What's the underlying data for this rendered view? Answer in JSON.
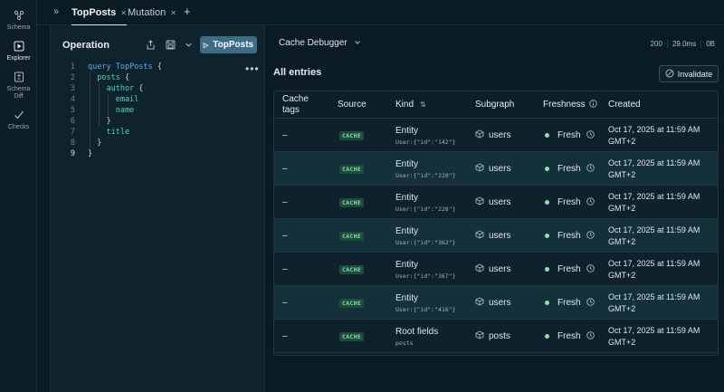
{
  "rail": {
    "items": [
      {
        "label": "Schema",
        "icon": "schema-icon"
      },
      {
        "label": "Explorer",
        "icon": "play-square-icon",
        "active": true
      },
      {
        "label": "Schema Diff",
        "icon": "diff-icon"
      },
      {
        "label": "Checks",
        "icon": "check-icon"
      }
    ]
  },
  "tabs": {
    "items": [
      {
        "label": "TopPosts",
        "active": true
      },
      {
        "label": "Mutation",
        "active": false
      }
    ],
    "add": "+"
  },
  "operation": {
    "title": "Operation",
    "run_label": "TopPosts",
    "code": [
      {
        "n": "1",
        "parts": [
          {
            "t": "query ",
            "c": "kw"
          },
          {
            "t": "TopPosts ",
            "c": "kw"
          },
          {
            "t": "{",
            "c": "plain"
          }
        ]
      },
      {
        "n": "2",
        "parts": [
          {
            "t": "  posts ",
            "c": "fld"
          },
          {
            "t": "{",
            "c": "plain"
          }
        ]
      },
      {
        "n": "3",
        "parts": [
          {
            "t": "    author ",
            "c": "fld"
          },
          {
            "t": "{",
            "c": "plain"
          }
        ]
      },
      {
        "n": "4",
        "parts": [
          {
            "t": "      email",
            "c": "fld"
          }
        ]
      },
      {
        "n": "5",
        "parts": [
          {
            "t": "      name",
            "c": "fld"
          }
        ]
      },
      {
        "n": "6",
        "parts": [
          {
            "t": "    }",
            "c": "plain"
          }
        ]
      },
      {
        "n": "7",
        "parts": [
          {
            "t": "    title",
            "c": "fld"
          }
        ]
      },
      {
        "n": "8",
        "parts": [
          {
            "t": "  }",
            "c": "plain"
          }
        ]
      },
      {
        "n": "9",
        "parts": [
          {
            "t": "}",
            "c": "plain"
          }
        ]
      }
    ]
  },
  "debugger": {
    "title": "Cache Debugger",
    "status": "200",
    "time": "29.0ms",
    "size": "0B",
    "entries_title": "All entries",
    "invalidate_label": "Invalidate"
  },
  "table": {
    "headers": {
      "tags_1": "Cache",
      "tags_2": "tags",
      "source": "Source",
      "kind": "Kind",
      "subgraph": "Subgraph",
      "freshness": "Freshness",
      "created": "Created"
    },
    "rows": [
      {
        "tags": "–",
        "source": "CACHE",
        "kind": "Entity",
        "key": "User:{\"id\":\"142\"}",
        "subgraph": "users",
        "freshness": "Fresh",
        "created_1": "Oct 17, 2025 at 11:59 AM",
        "created_2": "GMT+2"
      },
      {
        "tags": "–",
        "source": "CACHE",
        "kind": "Entity",
        "key": "User:{\"id\":\"220\"}",
        "subgraph": "users",
        "freshness": "Fresh",
        "created_1": "Oct 17, 2025 at 11:59 AM",
        "created_2": "GMT+2"
      },
      {
        "tags": "–",
        "source": "CACHE",
        "kind": "Entity",
        "key": "User:{\"id\":\"228\"}",
        "subgraph": "users",
        "freshness": "Fresh",
        "created_1": "Oct 17, 2025 at 11:59 AM",
        "created_2": "GMT+2"
      },
      {
        "tags": "–",
        "source": "CACHE",
        "kind": "Entity",
        "key": "User:{\"id\":\"362\"}",
        "subgraph": "users",
        "freshness": "Fresh",
        "created_1": "Oct 17, 2025 at 11:59 AM",
        "created_2": "GMT+2"
      },
      {
        "tags": "–",
        "source": "CACHE",
        "kind": "Entity",
        "key": "User:{\"id\":\"367\"}",
        "subgraph": "users",
        "freshness": "Fresh",
        "created_1": "Oct 17, 2025 at 11:59 AM",
        "created_2": "GMT+2"
      },
      {
        "tags": "–",
        "source": "CACHE",
        "kind": "Entity",
        "key": "User:{\"id\":\"416\"}",
        "subgraph": "users",
        "freshness": "Fresh",
        "created_1": "Oct 17, 2025 at 11:59 AM",
        "created_2": "GMT+2"
      },
      {
        "tags": "–",
        "source": "CACHE",
        "kind": "Root fields",
        "key": "posts",
        "subgraph": "posts",
        "freshness": "Fresh",
        "created_1": "Oct 17, 2025 at 11:59 AM",
        "created_2": "GMT+2"
      }
    ]
  },
  "colors": {
    "background": "#0b1b23",
    "panel": "#0f232d",
    "run_button": "#3e6b86",
    "badge_bg": "#1f4b3a",
    "badge_text": "#7fe0b0",
    "fresh_dot": "#8ee0a8",
    "status_ok": "#6fd3a3"
  }
}
